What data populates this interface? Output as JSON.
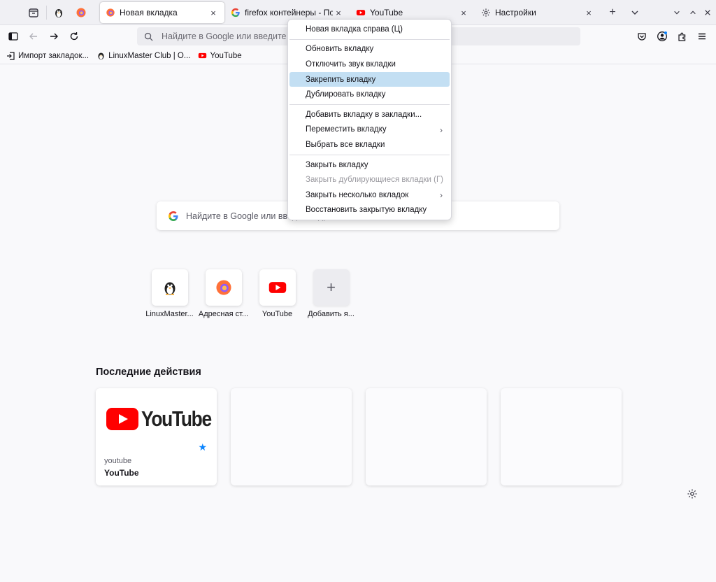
{
  "tabs": {
    "items": [
      {
        "label": "Новая вкладка",
        "active": true
      },
      {
        "label": "firefox контейнеры - Поиск в Google",
        "active": false
      },
      {
        "label": "YouTube",
        "active": false
      },
      {
        "label": "Настройки",
        "active": false
      }
    ],
    "close_glyph": "×",
    "new_tab_glyph": "+",
    "list_all_glyph": "⌄"
  },
  "navbar": {
    "url_placeholder": "Найдите в Google или введите адрес"
  },
  "bookmarks": [
    {
      "label": "Импорт закладок..."
    },
    {
      "label": "LinuxMaster Club | O..."
    },
    {
      "label": "YouTube"
    }
  ],
  "newtab": {
    "search_placeholder": "Найдите в Google или введите адрес",
    "shortcuts": [
      {
        "label": "LinuxMaster..."
      },
      {
        "label": "Адресная ст..."
      },
      {
        "label": "YouTube"
      },
      {
        "label": "Добавить я..."
      }
    ],
    "add_glyph": "+",
    "recent_title": "Последние действия",
    "recent_cards": [
      {
        "site": "youtube",
        "title": "YouTube",
        "logo_text": "YouTube"
      }
    ]
  },
  "context_menu": {
    "items": [
      {
        "label": "Новая вкладка справа (Ц)"
      },
      {
        "label": "Обновить вкладку"
      },
      {
        "label": "Отключить звук вкладки"
      },
      {
        "label": "Закрепить вкладку"
      },
      {
        "label": "Дублировать вкладку"
      },
      {
        "label": "Добавить вкладку в закладки..."
      },
      {
        "label": "Переместить вкладку"
      },
      {
        "label": "Выбрать все вкладки"
      },
      {
        "label": "Закрыть вкладку"
      },
      {
        "label": "Закрыть дублирующиеся вкладки (Г)"
      },
      {
        "label": "Закрыть несколько вкладок"
      },
      {
        "label": "Восстановить закрытую вкладку"
      }
    ],
    "submenu_glyph": "›"
  },
  "colors": {
    "accent": "#0a84ff",
    "highlight": "#c3dff3",
    "youtube_red": "#ff0000"
  }
}
